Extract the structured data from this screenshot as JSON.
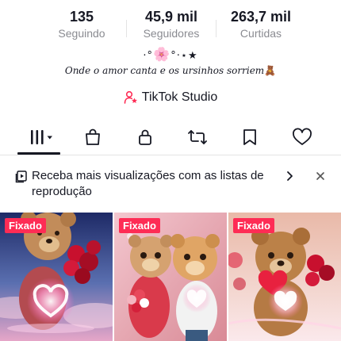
{
  "stats": {
    "following_count": "135",
    "following_label": "Seguindo",
    "followers_count": "45,9 mil",
    "followers_label": "Seguidores",
    "likes_count": "263,7 mil",
    "likes_label": "Curtidas"
  },
  "profile": {
    "deco_left": "·°",
    "deco_flower": "🌸",
    "deco_right": "°·⋆★",
    "bio": "Onde o amor canta e os ursinhos sorriem",
    "bio_emoji": "🧸",
    "studio_label": "TikTok Studio",
    "studio_icon": "user-star-icon"
  },
  "tabs": {
    "icons": [
      "grid-menu-icon",
      "shopping-bag-icon",
      "lock-icon",
      "repost-icon",
      "bookmark-icon",
      "heart-icon"
    ],
    "active_index": 0
  },
  "banner": {
    "text": "Receba mais visualizações com as listas de reprodução",
    "icon": "playlist-icon",
    "arrow_icon": "chevron-right-icon",
    "close_icon": "close-icon"
  },
  "videos": [
    {
      "pin_label": "Fixado"
    },
    {
      "pin_label": "Fixado"
    },
    {
      "pin_label": "Fixado"
    }
  ],
  "colors": {
    "accent": "#fe2c55",
    "text": "#161823",
    "muted": "#8a8b91",
    "divider": "#e3e3e4"
  }
}
